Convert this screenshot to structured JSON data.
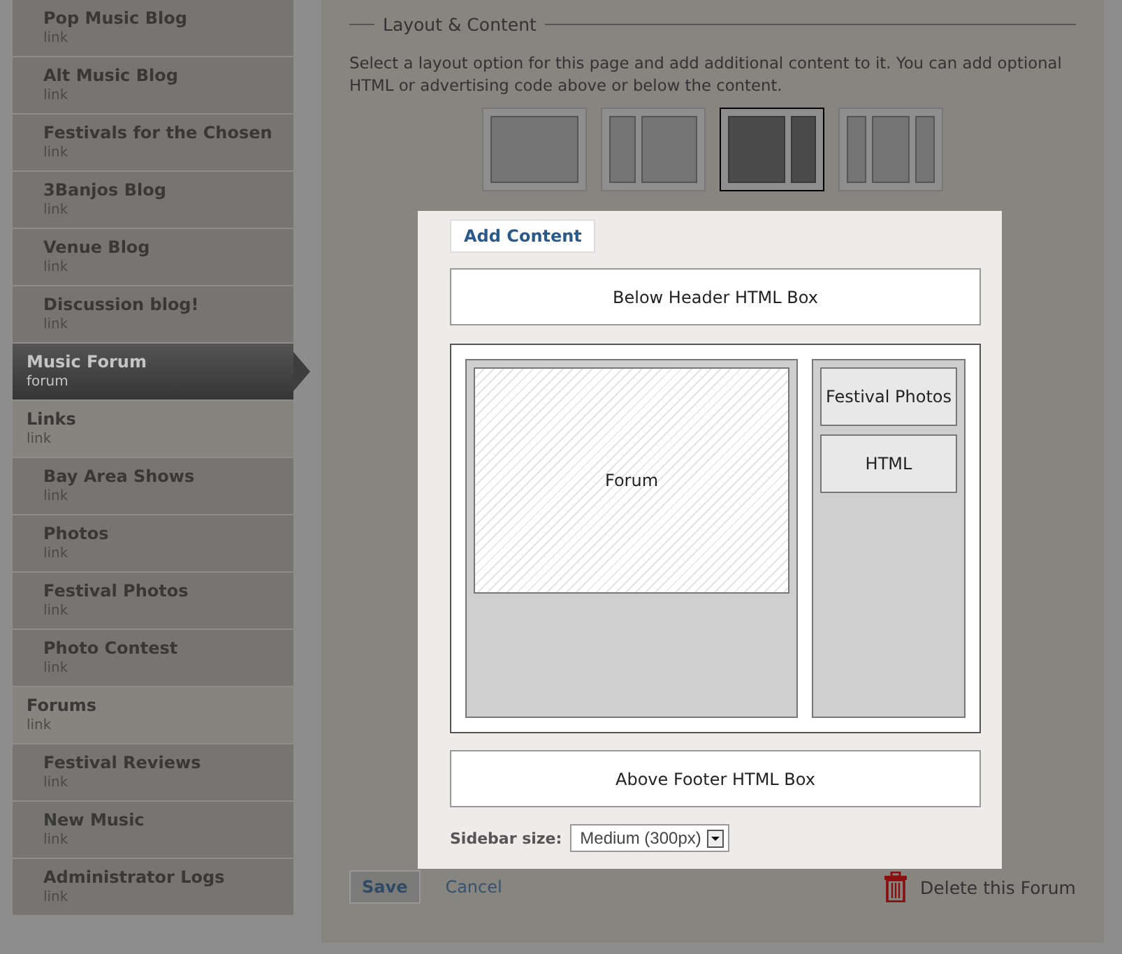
{
  "sidebar": {
    "continued_items": [
      {
        "label": "Pop Music Blog",
        "type": "link",
        "selected": false
      },
      {
        "label": "Alt Music Blog",
        "type": "link",
        "selected": false
      },
      {
        "label": "Festivals for the Chosen",
        "type": "link",
        "selected": false
      },
      {
        "label": "3Banjos Blog",
        "type": "link",
        "selected": false
      },
      {
        "label": "Venue Blog",
        "type": "link",
        "selected": false
      },
      {
        "label": "Discussion blog!",
        "type": "link",
        "selected": false
      }
    ],
    "items": [
      {
        "label": "Music Forum",
        "type": "forum",
        "selected": true
      },
      {
        "label": "Links",
        "type": "link",
        "selected": false,
        "children": [
          {
            "label": "Bay Area Shows",
            "type": "link",
            "selected": false
          },
          {
            "label": "Photos",
            "type": "link",
            "selected": false
          },
          {
            "label": "Festival Photos",
            "type": "link",
            "selected": false
          },
          {
            "label": "Photo Contest",
            "type": "link",
            "selected": false
          }
        ]
      },
      {
        "label": "Forums",
        "type": "link",
        "selected": false,
        "children": [
          {
            "label": "Festival Reviews",
            "type": "link",
            "selected": false
          },
          {
            "label": "New Music",
            "type": "link",
            "selected": false
          },
          {
            "label": "Administrator Logs",
            "type": "link",
            "selected": false
          }
        ]
      }
    ]
  },
  "section": {
    "legend": "Layout & Content",
    "description": "Select a layout option for this page and add additional content to it. You can add optional HTML or advertising code above or below the content.",
    "layout_options": [
      {
        "kind": "single",
        "selected": false
      },
      {
        "kind": "left-sidebar",
        "selected": false
      },
      {
        "kind": "right-sidebar",
        "selected": true
      },
      {
        "kind": "three-column",
        "selected": false
      }
    ]
  },
  "dialog": {
    "tab": "Add Content",
    "header_box": "Below Header HTML Box",
    "main_block": "Forum",
    "sidebar_blocks": [
      "Festival Photos",
      "HTML"
    ],
    "footer_box": "Above Footer HTML Box",
    "sidebar_size_label": "Sidebar size:",
    "sidebar_size_value": "Medium (300px)"
  },
  "actions": {
    "save": "Save",
    "cancel": "Cancel",
    "delete": "Delete this Forum"
  }
}
